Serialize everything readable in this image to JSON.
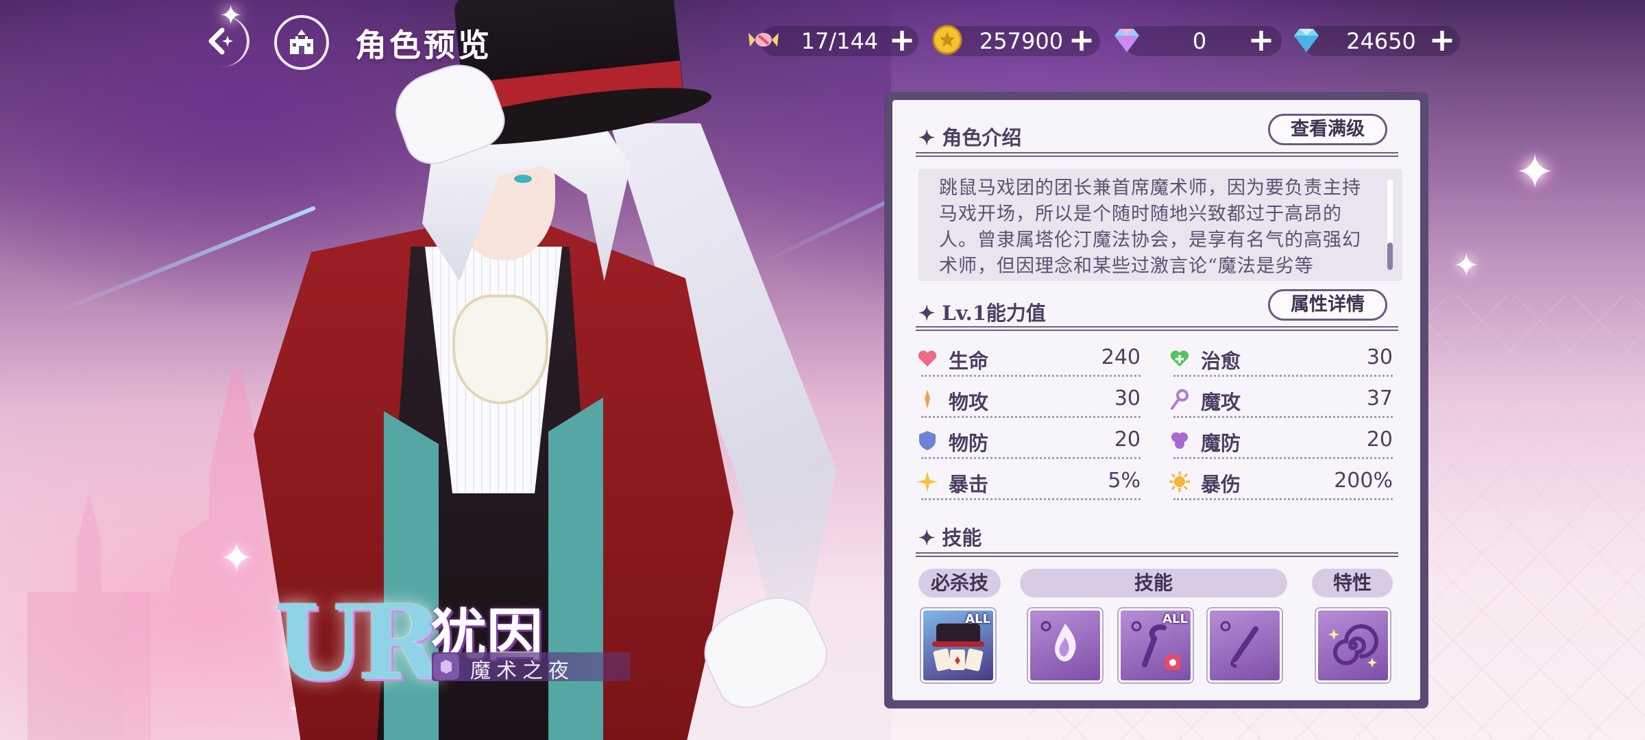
{
  "header": {
    "title": "角色预览",
    "resources": [
      {
        "icon": "candy-icon",
        "value": "17/144"
      },
      {
        "icon": "gold-coin-icon",
        "value": "257900"
      },
      {
        "icon": "rainbow-gem-icon",
        "value": "0"
      },
      {
        "icon": "diamond-icon",
        "value": "24650"
      }
    ]
  },
  "character": {
    "rarity": "UR",
    "name": "犹因",
    "subtitle": "魔术之夜"
  },
  "intro": {
    "heading": "角色介绍",
    "button": "查看满级",
    "text": "跳鼠马戏团的团长兼首席魔术师，因为要负责主持马戏开场，所以是个随时随地兴致都过于高昂的人。曾隶属塔伦汀魔法协会，是享有名气的高强幻术师，但因理念和某些过激言论“魔法是劣等"
  },
  "stats": {
    "heading": "Lv.1能力值",
    "button": "属性详情",
    "items": [
      {
        "label": "生命",
        "value": "240",
        "icon": "heart-icon",
        "color": "#f06a86"
      },
      {
        "label": "治愈",
        "value": "30",
        "icon": "heal-icon",
        "color": "#56c25f"
      },
      {
        "label": "物攻",
        "value": "30",
        "icon": "physical-attack-icon",
        "color": "#f0a24a"
      },
      {
        "label": "魔攻",
        "value": "37",
        "icon": "magic-attack-icon",
        "color": "#b17ad8"
      },
      {
        "label": "物防",
        "value": "20",
        "icon": "physical-defense-icon",
        "color": "#6d84d6"
      },
      {
        "label": "魔防",
        "value": "20",
        "icon": "magic-defense-icon",
        "color": "#a968d4"
      },
      {
        "label": "暴击",
        "value": "5%",
        "icon": "crit-rate-icon",
        "color": "#f5c33b"
      },
      {
        "label": "暴伤",
        "value": "200%",
        "icon": "crit-damage-icon",
        "color": "#f5b43b"
      }
    ]
  },
  "skills": {
    "heading": "技能",
    "tags": {
      "ultimate": "必杀技",
      "skill": "技能",
      "trait": "特性"
    },
    "badge_all": "ALL"
  },
  "colors": {
    "panel_border": "#5b4a72",
    "panel_bg": "#f7f5f9",
    "text": "#4e3e63",
    "accent": "#7e4fa8"
  }
}
